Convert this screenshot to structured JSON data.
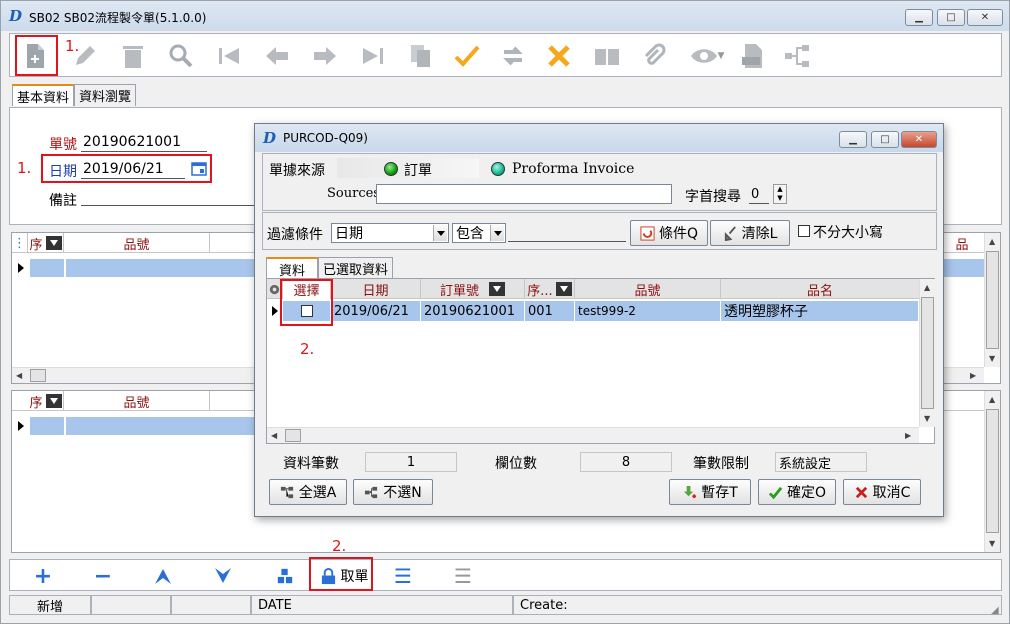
{
  "window": {
    "title": "SB02 SB02流程製令單(5.1.0.0)",
    "app_icon": "D"
  },
  "annotations": {
    "step1": "1.",
    "step2": "2."
  },
  "tabs": [
    "基本資料",
    "資料瀏覽"
  ],
  "form": {
    "doc_no_label": "單號",
    "doc_no_value": "20190621001",
    "date_label": "日期",
    "date_value": "2019/06/21",
    "remark_label": "備註"
  },
  "grid_top": {
    "col_seq": "序",
    "col_item": "品號",
    "col_right": "品"
  },
  "grid_bottom": {
    "col_seq": "序",
    "col_item": "品號"
  },
  "bottom_toolbar": {
    "fetch_label": "取單"
  },
  "statusbar": {
    "mode": "新增",
    "field": "DATE",
    "create_label": "Create:"
  },
  "dialog": {
    "title": "PURCOD-Q09)",
    "source_label": "單據來源",
    "source_opt1": "訂單",
    "source_opt2": "Proforma Invoice",
    "sources_label": "Sources",
    "sources_value": "",
    "prefix_label": "字首搜尋",
    "prefix_value": "0",
    "filter_label": "過濾條件",
    "filter_field": "日期",
    "filter_op": "包含",
    "filter_value": "",
    "condition_btn": "條件Q",
    "clear_btn": "清除L",
    "case_label": "不分大小寫",
    "tabs": [
      "資料",
      "已選取資料"
    ],
    "columns": [
      "選擇",
      "日期",
      "訂單號",
      "序...",
      "品號",
      "品名"
    ],
    "rows": [
      {
        "selected": false,
        "date": "2019/06/21",
        "order_no": "20190621001",
        "seq": "001",
        "item": "test999-2",
        "name": "透明塑膠杯子"
      }
    ],
    "record_count_label": "資料筆數",
    "record_count": "1",
    "field_count_label": "欄位數",
    "field_count": "8",
    "limit_label": "筆數限制",
    "limit_value": "系統設定",
    "select_all_btn": "全選A",
    "deselect_btn": "不選N",
    "hold_btn": "暫存T",
    "ok_btn": "確定O",
    "cancel_btn": "取消C"
  },
  "colors": {
    "accent_red": "#e2141b",
    "selection": "#a8c6ec",
    "header_text": "#8b1010"
  }
}
